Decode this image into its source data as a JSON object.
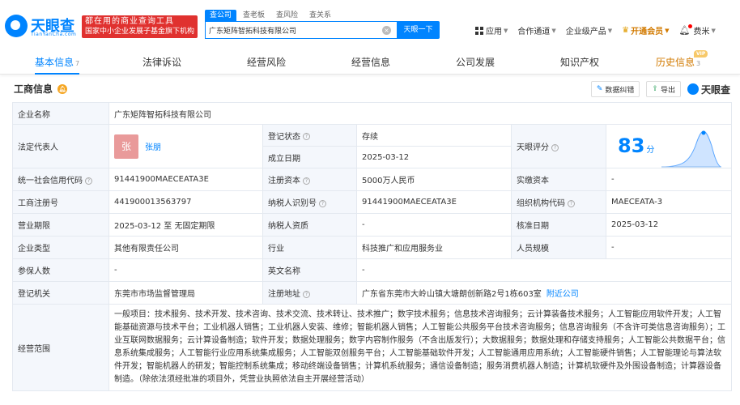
{
  "brand": {
    "name": "天眼查",
    "sub": "TianYanCha.com",
    "banner_line1": "都在用的商业查询工具",
    "banner_line2": "国家中小企业发展子基金旗下机构"
  },
  "search": {
    "tabs": [
      "查公司",
      "查老板",
      "查风险",
      "查关系"
    ],
    "value": "广东矩阵智拓科技有限公司",
    "button": "天眼一下"
  },
  "topnav": {
    "app": "应用",
    "partner": "合作通道",
    "enterprise": "企业级产品",
    "vip": "开通会员",
    "user": "费米"
  },
  "tabs": [
    {
      "label": "基本信息",
      "count": "7"
    },
    {
      "label": "法律诉讼",
      "count": ""
    },
    {
      "label": "经营风险",
      "count": ""
    },
    {
      "label": "经营信息",
      "count": ""
    },
    {
      "label": "公司发展",
      "count": ""
    },
    {
      "label": "知识产权",
      "count": ""
    },
    {
      "label": "历史信息",
      "count": "3"
    }
  ],
  "vip_badge": "VIP",
  "section": {
    "title": "工商信息",
    "error_btn": "数据纠错",
    "export_btn": "导出",
    "brand": "天眼查"
  },
  "info": {
    "company_name_k": "企业名称",
    "company_name_v": "广东矩阵智拓科技有限公司",
    "legal_rep_k": "法定代表人",
    "legal_rep_avatar": "张",
    "legal_rep_v": "张朋",
    "reg_status_k": "登记状态",
    "reg_status_v": "存续",
    "found_date_k": "成立日期",
    "found_date_v": "2025-03-12",
    "score_k": "天眼评分",
    "score_v": "83",
    "score_unit": "分",
    "credit_code_k": "统一社会信用代码",
    "credit_code_v": "91441900MAECEATA3E",
    "reg_capital_k": "注册资本",
    "reg_capital_v": "5000万人民币",
    "paid_capital_k": "实缴资本",
    "paid_capital_v": "-",
    "reg_no_k": "工商注册号",
    "reg_no_v": "441900013563797",
    "taxpayer_no_k": "纳税人识别号",
    "taxpayer_no_v": "91441900MAECEATA3E",
    "org_code_k": "组织机构代码",
    "org_code_v": "MAECEATA-3",
    "term_k": "营业期限",
    "term_v": "2025-03-12 至 无固定期限",
    "taxpayer_qual_k": "纳税人资质",
    "taxpayer_qual_v": "-",
    "approve_date_k": "核准日期",
    "approve_date_v": "2025-03-12",
    "type_k": "企业类型",
    "type_v": "其他有限责任公司",
    "industry_k": "行业",
    "industry_v": "科技推广和应用服务业",
    "staff_k": "人员规模",
    "staff_v": "-",
    "insured_k": "参保人数",
    "insured_v": "-",
    "en_name_k": "英文名称",
    "en_name_v": "-",
    "authority_k": "登记机关",
    "authority_v": "东莞市市场监督管理局",
    "address_k": "注册地址",
    "address_v": "广东省东莞市大岭山镇大塘朗创新路2号1栋603室",
    "nearby": "附近公司",
    "scope_k": "经营范围",
    "scope_v": "一般项目：技术服务、技术开发、技术咨询、技术交流、技术转让、技术推广；数字技术服务；信息技术咨询服务；云计算装备技术服务；人工智能应用软件开发；人工智能基础资源与技术平台；工业机器人销售；工业机器人安装、维修；智能机器人销售；人工智能公共服务平台技术咨询服务；信息咨询服务（不含许可类信息咨询服务）；工业互联网数据服务；云计算设备制造；软件开发；数据处理服务；数字内容制作服务（不含出版发行）；大数据服务；数据处理和存储支持服务；人工智能公共数据平台；信息系统集成服务；人工智能行业应用系统集成服务；人工智能双创服务平台；人工智能基础软件开发；人工智能通用应用系统；人工智能硬件销售；人工智能理论与算法软件开发；智能机器人的研发；智能控制系统集成；移动终端设备销售；计算机系统服务；通信设备制造；服务消费机器人制造；计算机软硬件及外围设备制造；计算器设备制造。（除依法须经批准的项目外，凭营业执照依法自主开展经营活动）"
  }
}
